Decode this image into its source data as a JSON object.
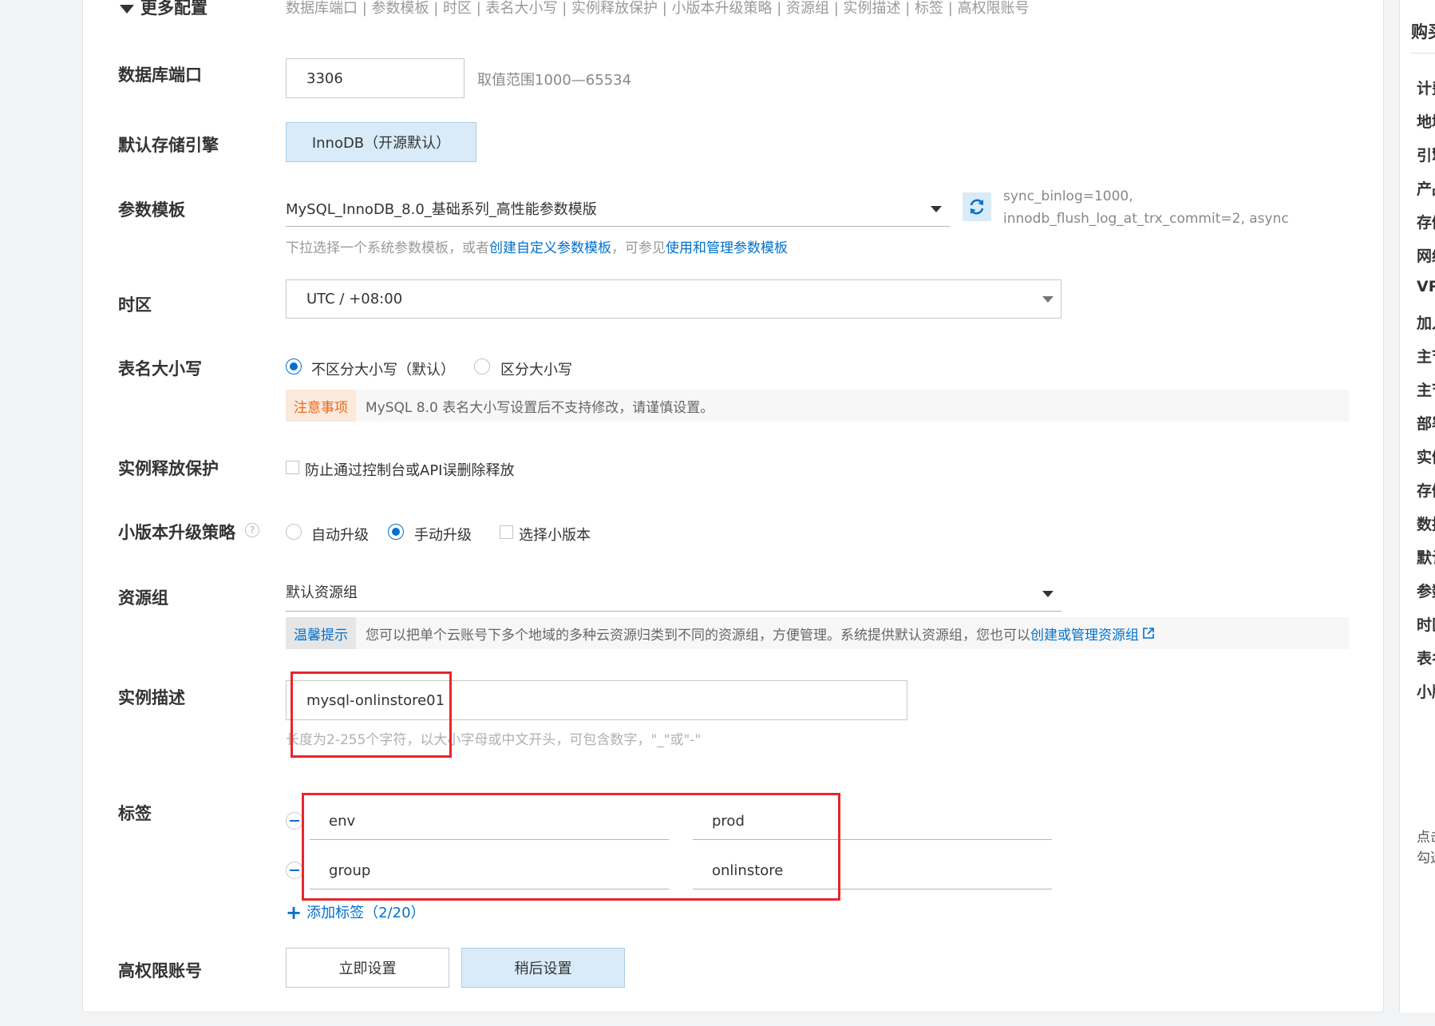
{
  "section": {
    "toggle_label": "更多配置",
    "nav_links": "数据库端口 | 参数模板 | 时区 | 表名大小写 | 实例释放保护 | 小版本升级策略 | 资源组 | 实例描述 | 标签 | 高权限账号"
  },
  "port": {
    "label": "数据库端口",
    "value": "3306",
    "range_hint": "取值范围1000—65534"
  },
  "engine": {
    "label": "默认存储引擎",
    "option": "InnoDB（开源默认）"
  },
  "param_template": {
    "label": "参数模板",
    "selected": "MySQL_InnoDB_8.0_基础系列_高性能参数模版",
    "info_line1": "sync_binlog=1000,",
    "info_line2": "innodb_flush_log_at_trx_commit=2, async",
    "hint_prefix": "下拉选择一个系统参数模板，或者",
    "hint_link1": "创建自定义参数模板",
    "hint_middle": "，可参见",
    "hint_link2": "使用和管理参数模板"
  },
  "timezone": {
    "label": "时区",
    "selected": "UTC / +08:00"
  },
  "case": {
    "label": "表名大小写",
    "option1": "不区分大小写（默认）",
    "option2": "区分大小写",
    "notice_tag": "注意事项",
    "notice_text": "MySQL 8.0 表名大小写设置后不支持修改，请谨慎设置。",
    "notice_tag_color": "#e96a1c"
  },
  "release_protection": {
    "label": "实例释放保护",
    "checkbox_label": "防止通过控制台或API误删除释放"
  },
  "upgrade": {
    "label": "小版本升级策略",
    "option_auto": "自动升级",
    "option_manual": "手动升级",
    "checkbox_label": "选择小版本"
  },
  "resource_group": {
    "label": "资源组",
    "selected": "默认资源组",
    "tip_tag": "温馨提示",
    "tip_text": "您可以把单个云账号下多个地域的多种云资源归类到不同的资源组，方便管理。系统提供默认资源组，您也可以",
    "tip_link": "创建或管理资源组"
  },
  "description": {
    "label": "实例描述",
    "value": "mysql-onlinstore01",
    "hint": "长度为2-255个字符，以大小字母或中文开头，可包含数字，\"_\"或\"-\""
  },
  "tags": {
    "label": "标签",
    "rows": [
      {
        "key": "env",
        "value": "prod"
      },
      {
        "key": "group",
        "value": "onlinstore"
      }
    ],
    "add_label": "添加标签（2/20）"
  },
  "admin_account": {
    "label": "高权限账号",
    "btn_now": "立即设置",
    "btn_later": "稍后设置"
  },
  "sidebar": {
    "title": "购买",
    "items": [
      "计费",
      "地域",
      "引擎",
      "产品",
      "存储",
      "网络",
      "VPC",
      "加入",
      "主节",
      "主节",
      "部署",
      "实例",
      "存储",
      "数据",
      "默认",
      "参数",
      "时区",
      "表名",
      "小版"
    ],
    "note_line1": "点击",
    "note_line2": "勾选"
  },
  "colors": {
    "accent": "#0070cc",
    "highlight": "#e8262a",
    "selected_bg": "#d9ebf8"
  }
}
